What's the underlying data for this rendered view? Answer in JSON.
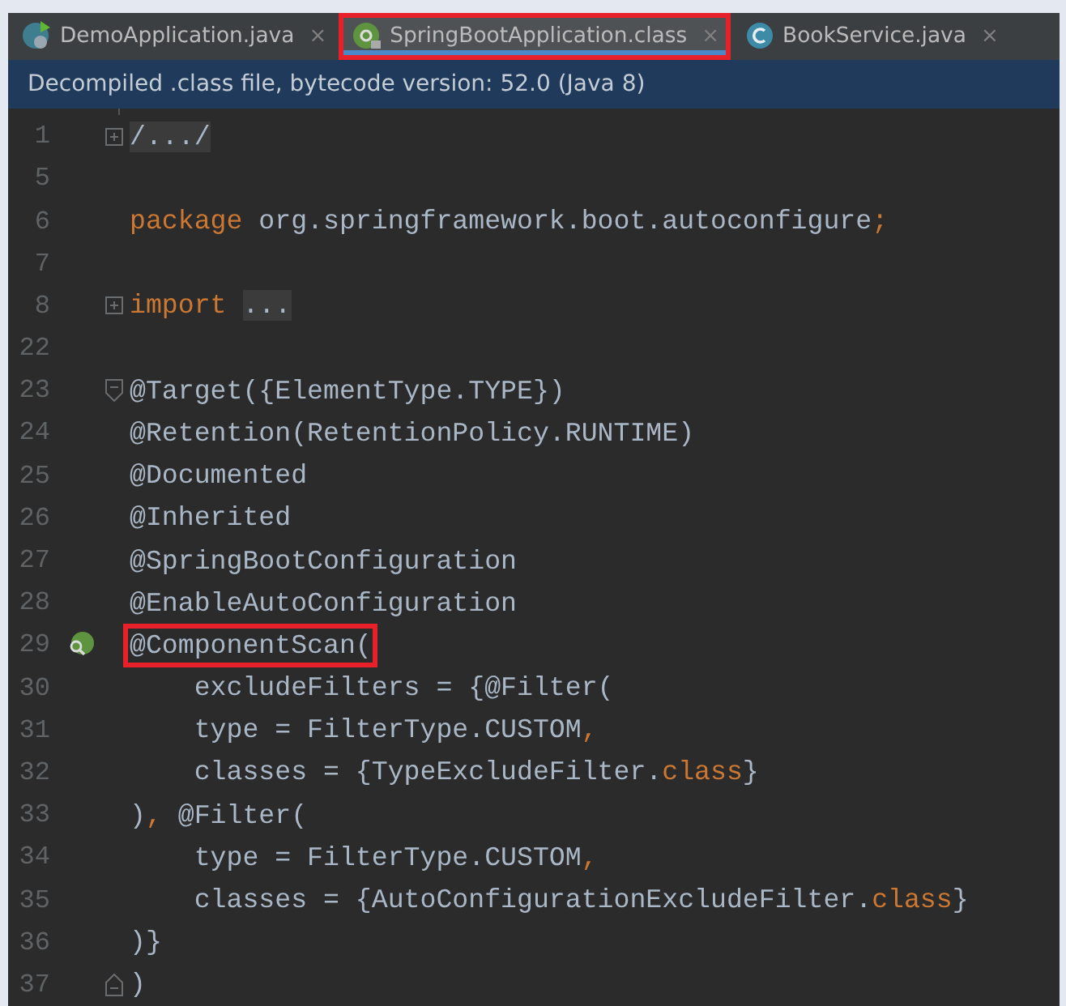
{
  "tabs": [
    {
      "label": "DemoApplication.java",
      "kind": "spring-app",
      "selected": false,
      "highlighted": false,
      "close": "×"
    },
    {
      "label": "SpringBootApplication.class",
      "kind": "annotation",
      "selected": true,
      "highlighted": true,
      "close": "×"
    },
    {
      "label": "BookService.java",
      "kind": "class",
      "selected": false,
      "highlighted": false,
      "close": "×"
    }
  ],
  "banner": {
    "text": "Decompiled .class file, bytecode version: 52.0 (Java 8)"
  },
  "editor": {
    "lines": [
      {
        "number": "1",
        "fold_marker": {
          "kind": "expand"
        },
        "segments": [
          {
            "text": "/.../",
            "kind": "folded"
          }
        ]
      },
      {
        "number": "5"
      },
      {
        "number": "6",
        "segments": [
          {
            "text": "package",
            "kind": "keyword"
          },
          {
            "text": " org.springframework.boot.autoconfigure",
            "kind": "plain"
          },
          {
            "text": ";",
            "kind": "keyword"
          }
        ]
      },
      {
        "number": "7"
      },
      {
        "number": "8",
        "fold_marker": {
          "kind": "expand"
        },
        "segments": [
          {
            "text": "import",
            "kind": "keyword"
          },
          {
            "text": "...",
            "kind": "folded"
          }
        ]
      },
      {
        "number": "22"
      },
      {
        "number": "23",
        "fold_marker": {
          "kind": "start"
        },
        "segments": [
          {
            "text": "@Target({ElementType.TYPE})",
            "kind": "plain"
          }
        ]
      },
      {
        "number": "24",
        "segments": [
          {
            "text": "@Retention(RetentionPolicy.RUNTIME)",
            "kind": "plain"
          }
        ]
      },
      {
        "number": "25",
        "segments": [
          {
            "text": "@Documented",
            "kind": "plain"
          }
        ]
      },
      {
        "number": "26",
        "segments": [
          {
            "text": "@Inherited",
            "kind": "plain"
          }
        ]
      },
      {
        "number": "27",
        "segments": [
          {
            "text": "@SpringBootConfiguration",
            "kind": "plain"
          }
        ]
      },
      {
        "number": "28",
        "segments": [
          {
            "text": "@EnableAutoConfiguration",
            "kind": "plain"
          }
        ]
      },
      {
        "number": "29",
        "gutter_marker": {
          "kind": "bean"
        },
        "segments": [
          {
            "text": "@ComponentScan(",
            "kind": "plain",
            "highlighted": true
          }
        ]
      },
      {
        "number": "30",
        "segments": [
          {
            "text": "    excludeFilters = {@Filter(",
            "kind": "plain"
          }
        ]
      },
      {
        "number": "31",
        "segments": [
          {
            "text": "    type = FilterType.CUSTOM",
            "kind": "plain"
          },
          {
            "text": ",",
            "kind": "keyword"
          }
        ]
      },
      {
        "number": "32",
        "segments": [
          {
            "text": "    classes = {TypeExcludeFilter.",
            "kind": "plain"
          },
          {
            "text": "class",
            "kind": "keyword"
          },
          {
            "text": "}",
            "kind": "plain"
          }
        ]
      },
      {
        "number": "33",
        "segments": [
          {
            "text": ")",
            "kind": "plain"
          },
          {
            "text": ",",
            "kind": "keyword"
          },
          {
            "text": " @Filter(",
            "kind": "plain"
          }
        ]
      },
      {
        "number": "34",
        "segments": [
          {
            "text": "    type = FilterType.CUSTOM",
            "kind": "plain"
          },
          {
            "text": ",",
            "kind": "keyword"
          }
        ]
      },
      {
        "number": "35",
        "segments": [
          {
            "text": "    classes = {AutoConfigurationExcludeFilter.",
            "kind": "plain"
          },
          {
            "text": "class",
            "kind": "keyword"
          },
          {
            "text": "}",
            "kind": "plain"
          }
        ]
      },
      {
        "number": "36",
        "segments": [
          {
            "text": ")}",
            "kind": "plain"
          }
        ]
      },
      {
        "number": "37",
        "fold_marker": {
          "kind": "end"
        },
        "segments": [
          {
            "text": ")",
            "kind": "plain"
          }
        ]
      }
    ]
  }
}
